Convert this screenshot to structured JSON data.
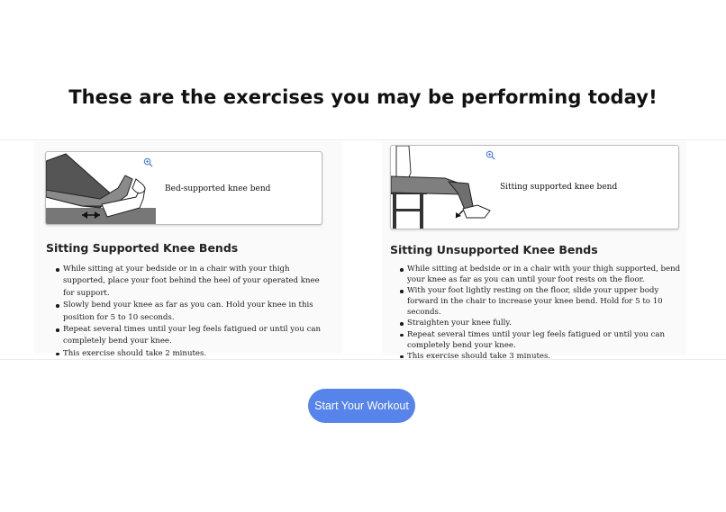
{
  "page": {
    "title": "These are the exercises you may be performing today!"
  },
  "exercises": [
    {
      "image_caption": "Bed-supported knee bend",
      "title": "Sitting Supported Knee Bends",
      "steps": [
        "While sitting at your bedside or in a chair with your thigh supported, place your foot behind the heel of your operated knee for support.",
        "Slowly bend your knee as far as you can. Hold your knee in this position for 5 to 10 seconds.",
        "Repeat several times until your leg feels fatigued or until you can completely bend your knee.",
        "This exercise should take 2 minutes."
      ]
    },
    {
      "image_caption": "Sitting supported knee bend",
      "title": "Sitting Unsupported Knee Bends",
      "steps": [
        "While sitting at bedside or in a chair with your thigh supported, bend your knee as far as you can until your foot rests on the floor.",
        "With your foot lightly resting on the floor, slide your upper body forward in the chair to increase your knee bend. Hold for 5 to 10 seconds.",
        "Straighten your knee fully.",
        "Repeat several times until your leg feels fatigued or until you can completely bend your knee.",
        "This exercise should take 3 minutes."
      ]
    }
  ],
  "actions": {
    "start_label": "Start Your Workout"
  },
  "colors": {
    "accent": "#5684ea",
    "zoom_icon": "#4a7de0"
  },
  "icons": {
    "zoom": "zoom-in-icon"
  }
}
